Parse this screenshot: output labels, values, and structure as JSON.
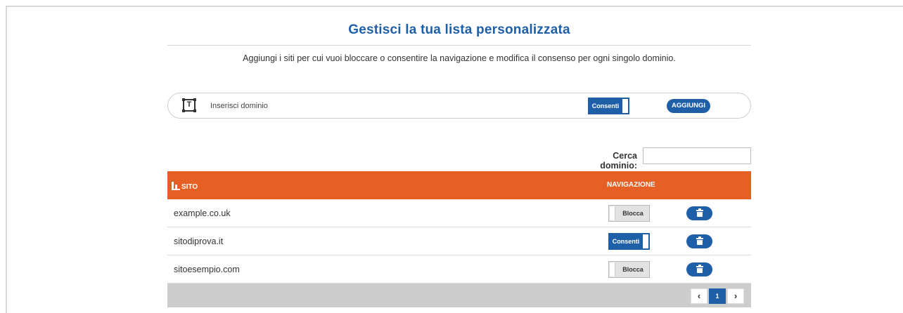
{
  "header": {
    "title": "Gestisci la tua lista personalizzata",
    "subtitle": "Aggiungi i siti per cui vuoi bloccare o consentire la navigazione e modifica il consenso per ogni singolo dominio."
  },
  "add_form": {
    "domain_placeholder": "Inserisci dominio",
    "toggle_label": "Consenti",
    "add_button": "AGGIUNGI",
    "icon": "text-field-icon"
  },
  "search": {
    "label": "Cerca dominio:",
    "value": ""
  },
  "table": {
    "columns": [
      "SITO",
      "NAVIGAZIONE"
    ],
    "rows": [
      {
        "site": "example.co.uk",
        "navigation": "Blocca",
        "allowed": false
      },
      {
        "site": "sitodiprova.it",
        "navigation": "Consenti",
        "allowed": true
      },
      {
        "site": "sitoesempio.com",
        "navigation": "Blocca",
        "allowed": false
      }
    ]
  },
  "pagination": {
    "prev": "‹",
    "current": "1",
    "next": "›"
  },
  "colors": {
    "accent": "#1f5fa8",
    "header": "#e65f25",
    "footer": "#cdcdcd"
  }
}
